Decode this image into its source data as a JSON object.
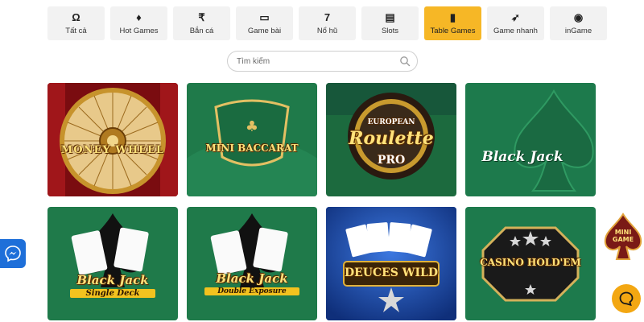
{
  "categories": [
    {
      "label": "Tất cả",
      "icon": "omega-icon",
      "glyph": "Ω"
    },
    {
      "label": "Hot Games",
      "icon": "diamond-icon",
      "glyph": "♦"
    },
    {
      "label": "Bắn cá",
      "icon": "rupee-icon",
      "glyph": "₹"
    },
    {
      "label": "Game bài",
      "icon": "cards-icon",
      "glyph": "▭"
    },
    {
      "label": "Nổ hũ",
      "icon": "seven-icon",
      "glyph": "7"
    },
    {
      "label": "Slots",
      "icon": "slot-machine-icon",
      "glyph": "▤"
    },
    {
      "label": "Table Games",
      "icon": "phone-icon",
      "glyph": "▮"
    },
    {
      "label": "Game nhanh",
      "icon": "rocket-icon",
      "glyph": "➶"
    },
    {
      "label": "inGame",
      "icon": "record-icon",
      "glyph": "◉"
    }
  ],
  "active_category": "Table Games",
  "search": {
    "placeholder": "Tìm kiếm",
    "value": ""
  },
  "games": [
    {
      "title": "MONEY WHEEL"
    },
    {
      "title": "MINI BACCARAT"
    },
    {
      "title_top": "EUROPEAN",
      "title": "Roulette",
      "title_bottom": "PRO"
    },
    {
      "title": "Black Jack"
    },
    {
      "title": "Black Jack",
      "subtitle": "Single Deck"
    },
    {
      "title": "Black Jack",
      "subtitle": "Double Exposure"
    },
    {
      "title": "DEUCES WILD"
    },
    {
      "title": "CASINO HOLD'EM"
    }
  ],
  "widgets": {
    "minigame_label_1": "MINI",
    "minigame_label_2": "GAME"
  },
  "colors": {
    "accent": "#f6b726",
    "tab_bg": "#f2f2f2",
    "felt": "#1f7a4a",
    "messenger": "#1e6fd9",
    "chat": "#f3a712"
  }
}
